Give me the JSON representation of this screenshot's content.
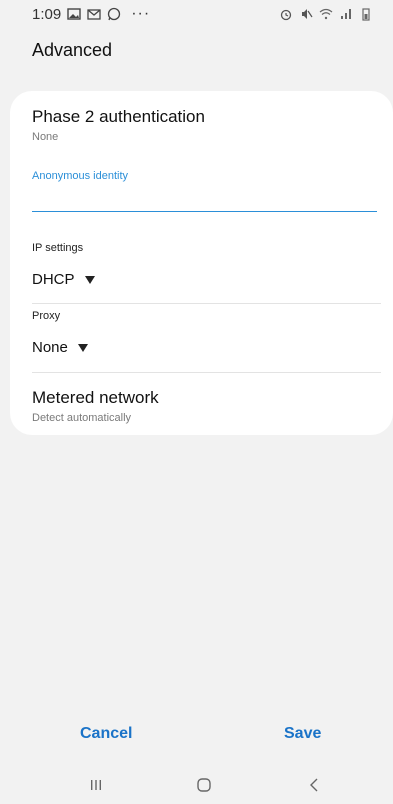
{
  "status_bar": {
    "time": "1:09",
    "left_icons": [
      "gallery-icon",
      "gmail-icon",
      "whatsapp-icon"
    ],
    "overflow": "···",
    "right_icons": [
      "alarm-icon",
      "mute-icon",
      "wifi-icon",
      "signal-icon",
      "battery-icon"
    ]
  },
  "page": {
    "title": "Advanced"
  },
  "settings": {
    "phase2": {
      "title": "Phase 2 authentication",
      "value": "None"
    },
    "anonymous_identity": {
      "label": "Anonymous identity",
      "value": "",
      "placeholder": ""
    },
    "ip_settings": {
      "label": "IP settings",
      "value": "DHCP"
    },
    "proxy": {
      "label": "Proxy",
      "value": "None"
    },
    "metered": {
      "title": "Metered network",
      "value": "Detect automatically"
    }
  },
  "footer": {
    "cancel_label": "Cancel",
    "save_label": "Save"
  },
  "nav": {
    "recents_icon": "recents-icon",
    "home_icon": "home-icon",
    "back_icon": "back-icon"
  },
  "colors": {
    "accent": "#2b8fd8",
    "button_text": "#1a73c8",
    "background": "#f2f2f2",
    "card": "#ffffff"
  }
}
